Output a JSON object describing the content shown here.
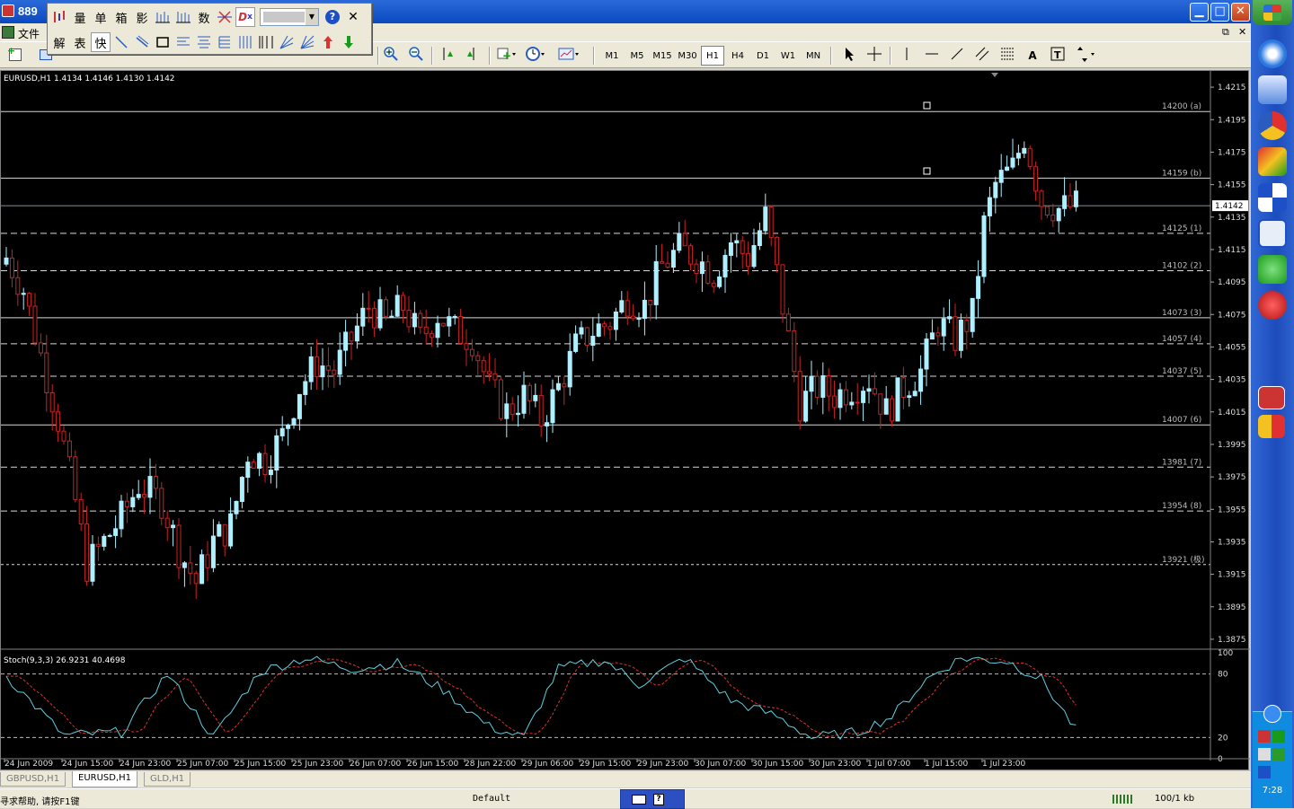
{
  "window": {
    "title": "889",
    "min": "▁",
    "max": "□",
    "close": "✕"
  },
  "float_toolbar": {
    "row1": [
      "量",
      "单",
      "箱",
      "影",
      "",
      "",
      "数",
      "",
      ""
    ],
    "row2": [
      "解",
      "表",
      "快"
    ],
    "help": "?",
    "close": "✕"
  },
  "menubar": {
    "file": "文件",
    "restore": "⧉",
    "close": "✕"
  },
  "toolbar": {
    "timeframes": [
      "M1",
      "M5",
      "M15",
      "M30",
      "H1",
      "H4",
      "D1",
      "W1",
      "MN"
    ],
    "active_tf": "H1",
    "text_tool": "A"
  },
  "chart": {
    "header": "EURUSD,H1  1.4134 1.4146 1.4130 1.4142",
    "indicator_header": "Stoch(9,3,3) 26.9231 40.4698",
    "current_price": "1.4142",
    "price_axis": [
      "1.4215",
      "1.4195",
      "1.4175",
      "1.4155",
      "1.4135",
      "1.4115",
      "1.4095",
      "1.4075",
      "1.4055",
      "1.4035",
      "1.4015",
      "1.3995",
      "1.3975",
      "1.3955",
      "1.3935",
      "1.3915",
      "1.3895",
      "1.3875"
    ],
    "stoch_axis": [
      "100",
      "80",
      "20",
      "0"
    ],
    "time_axis": [
      "24 Jun 2009",
      "24 Jun 15:00",
      "24 Jun 23:00",
      "25 Jun 07:00",
      "25 Jun 15:00",
      "25 Jun 23:00",
      "26 Jun 07:00",
      "26 Jun 15:00",
      "28 Jun 22:00",
      "29 Jun 06:00",
      "29 Jun 15:00",
      "29 Jun 23:00",
      "30 Jun 07:00",
      "30 Jun 15:00",
      "30 Jun 23:00",
      "1 Jul 07:00",
      "1 Jul 15:00",
      "1 Jul 23:00"
    ],
    "levels": [
      {
        "label": "14200 (a)",
        "price": 1.42,
        "style": "solid"
      },
      {
        "label": "14159 (b)",
        "price": 1.4159,
        "style": "solid"
      },
      {
        "label": "14125 (1)",
        "price": 1.4125,
        "style": "dash"
      },
      {
        "label": "14102 (2)",
        "price": 1.4102,
        "style": "dash"
      },
      {
        "label": "14073 (3)",
        "price": 1.4073,
        "style": "solid"
      },
      {
        "label": "14057 (4)",
        "price": 1.4057,
        "style": "dash"
      },
      {
        "label": "14037 (5)",
        "price": 1.4037,
        "style": "dash"
      },
      {
        "label": "14007 (6)",
        "price": 1.4007,
        "style": "solid"
      },
      {
        "label": "13981 (7)",
        "price": 1.3981,
        "style": "dash"
      },
      {
        "label": "13954 (8)",
        "price": 1.3954,
        "style": "dash"
      },
      {
        "label": "13921 (极)",
        "price": 1.3921,
        "style": "dot"
      }
    ]
  },
  "chart_data": {
    "type": "candlestick",
    "symbol": "EURUSD",
    "timeframe": "H1",
    "ylim": [
      1.387,
      1.4225
    ],
    "bull_color": "#aef0ff",
    "bear_color": "#cc2222",
    "close_anchors": [
      [
        0,
        1.411
      ],
      [
        3,
        1.409
      ],
      [
        6,
        1.405
      ],
      [
        9,
        1.401
      ],
      [
        12,
        1.396
      ],
      [
        14,
        1.392
      ],
      [
        17,
        1.3935
      ],
      [
        20,
        1.395
      ],
      [
        23,
        1.397
      ],
      [
        27,
        1.396
      ],
      [
        30,
        1.393
      ],
      [
        33,
        1.391
      ],
      [
        36,
        1.3935
      ],
      [
        39,
        1.3945
      ],
      [
        42,
        1.399
      ],
      [
        45,
        1.3985
      ],
      [
        48,
        1.4
      ],
      [
        51,
        1.403
      ],
      [
        54,
        1.4045
      ],
      [
        57,
        1.404
      ],
      [
        60,
        1.406
      ],
      [
        63,
        1.408
      ],
      [
        66,
        1.407
      ],
      [
        69,
        1.408
      ],
      [
        72,
        1.406
      ],
      [
        75,
        1.4075
      ],
      [
        78,
        1.4065
      ],
      [
        81,
        1.406
      ],
      [
        84,
        1.403
      ],
      [
        87,
        1.4015
      ],
      [
        90,
        1.4025
      ],
      [
        93,
        1.401
      ],
      [
        96,
        1.403
      ],
      [
        99,
        1.4055
      ],
      [
        102,
        1.4065
      ],
      [
        105,
        1.407
      ],
      [
        108,
        1.4085
      ],
      [
        111,
        1.408
      ],
      [
        114,
        1.4105
      ],
      [
        117,
        1.4115
      ],
      [
        120,
        1.411
      ],
      [
        123,
        1.41
      ],
      [
        126,
        1.412
      ],
      [
        129,
        1.411
      ],
      [
        132,
        1.4135
      ],
      [
        134,
        1.41
      ],
      [
        136,
        1.406
      ],
      [
        138,
        1.402
      ],
      [
        141,
        1.403
      ],
      [
        144,
        1.4025
      ],
      [
        147,
        1.403
      ],
      [
        150,
        1.4035
      ],
      [
        153,
        1.4015
      ],
      [
        156,
        1.403
      ],
      [
        159,
        1.404
      ],
      [
        162,
        1.407
      ],
      [
        165,
        1.406
      ],
      [
        168,
        1.4075
      ],
      [
        170,
        1.413
      ],
      [
        172,
        1.4155
      ],
      [
        175,
        1.4165
      ],
      [
        177,
        1.4185
      ],
      [
        180,
        1.4145
      ],
      [
        183,
        1.414
      ],
      [
        186,
        1.4142
      ]
    ],
    "count": 187,
    "stoch_main_anchors": [
      [
        0,
        78
      ],
      [
        10,
        22
      ],
      [
        20,
        25
      ],
      [
        28,
        80
      ],
      [
        36,
        20
      ],
      [
        44,
        82
      ],
      [
        52,
        95
      ],
      [
        60,
        85
      ],
      [
        68,
        90
      ],
      [
        76,
        65
      ],
      [
        84,
        30
      ],
      [
        90,
        20
      ],
      [
        96,
        85
      ],
      [
        104,
        93
      ],
      [
        110,
        70
      ],
      [
        118,
        95
      ],
      [
        126,
        55
      ],
      [
        134,
        40
      ],
      [
        140,
        20
      ],
      [
        148,
        25
      ],
      [
        154,
        40
      ],
      [
        160,
        75
      ],
      [
        166,
        95
      ],
      [
        174,
        92
      ],
      [
        180,
        75
      ],
      [
        186,
        27
      ]
    ],
    "stoch_signal_offset": 2,
    "stoch_levels": [
      80,
      20
    ]
  },
  "tabs": [
    "GBPUSD,H1",
    "EURUSD,H1",
    "GLD,H1"
  ],
  "active_tab": "EURUSD,H1",
  "statusbar": {
    "help": "寻求帮助, 请按F1键",
    "profile": "Default",
    "connection": "100/1 kb"
  },
  "taskbar": {
    "time": "7:28"
  }
}
